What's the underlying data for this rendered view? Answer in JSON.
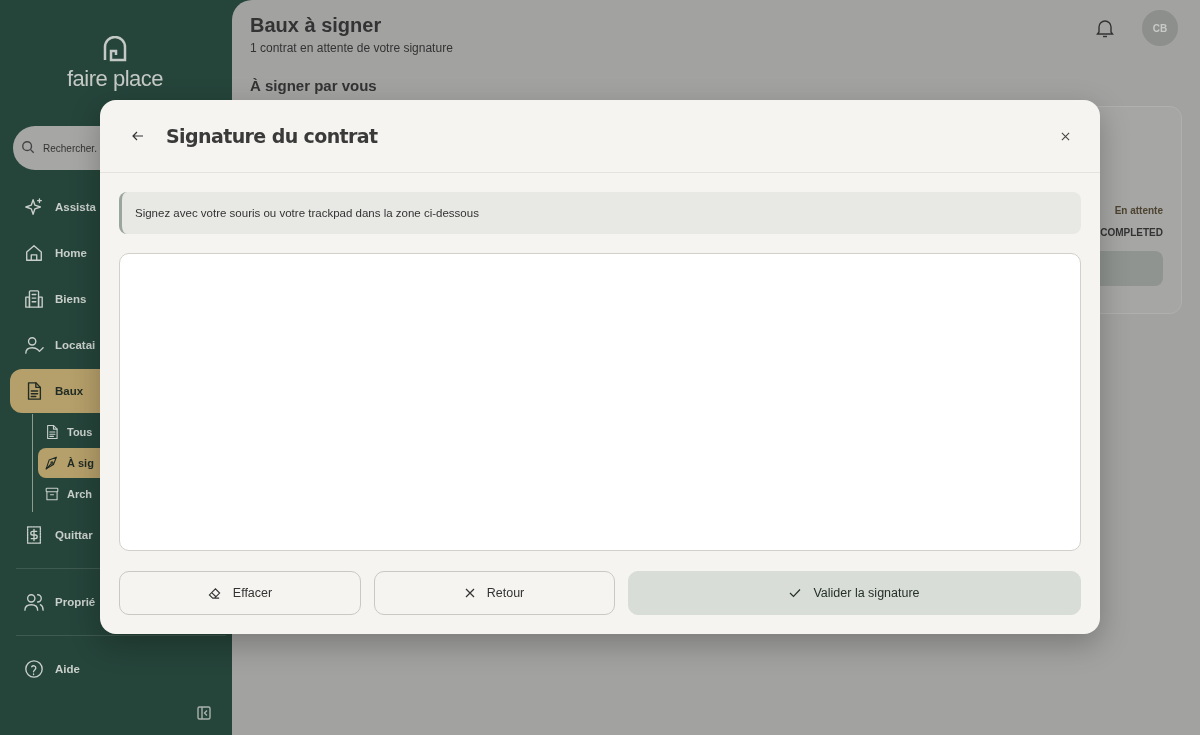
{
  "sidebar": {
    "logo": "faire place",
    "search": {
      "placeholder": "Rechercher."
    },
    "groups": [
      [
        {
          "label": "Assista",
          "kind": "sparkle",
          "selected": false
        },
        {
          "label": "Home",
          "kind": "home",
          "selected": false
        },
        {
          "label": "Biens",
          "kind": "building",
          "selected": false
        },
        {
          "label": "Locatai",
          "kind": "user-check",
          "selected": false
        },
        {
          "label": "Baux",
          "kind": "document",
          "selected": true,
          "expanded": true,
          "children": [
            {
              "label": "Tous",
              "kind": "document",
              "selected": false
            },
            {
              "label": "À sig",
              "kind": "pen",
              "selected": true
            },
            {
              "label": "Arch",
              "kind": "archive",
              "selected": false
            }
          ]
        },
        {
          "label": "Quittar",
          "kind": "receipt",
          "selected": false
        }
      ],
      [
        {
          "label": "Proprié",
          "kind": "users",
          "selected": false
        }
      ],
      [
        {
          "label": "Aide",
          "kind": "help",
          "selected": false
        }
      ]
    ]
  },
  "header": {
    "title": "Baux à signer",
    "subtitle": "1 contrat en attente de votre signature",
    "avatar": "CB"
  },
  "section_title": "À signer par vous",
  "lease_card": {
    "status": "En attente",
    "state": "COMPLETED"
  },
  "dialog": {
    "title": "Signature du contrat",
    "hint": "Signez avec votre souris ou votre trackpad dans la zone ci-dessous",
    "buttons": [
      {
        "label": "Effacer",
        "kind": "eraser"
      },
      {
        "label": "Retour",
        "kind": "cancel"
      },
      {
        "label": "Valider la signature",
        "kind": "confirm"
      }
    ]
  }
}
